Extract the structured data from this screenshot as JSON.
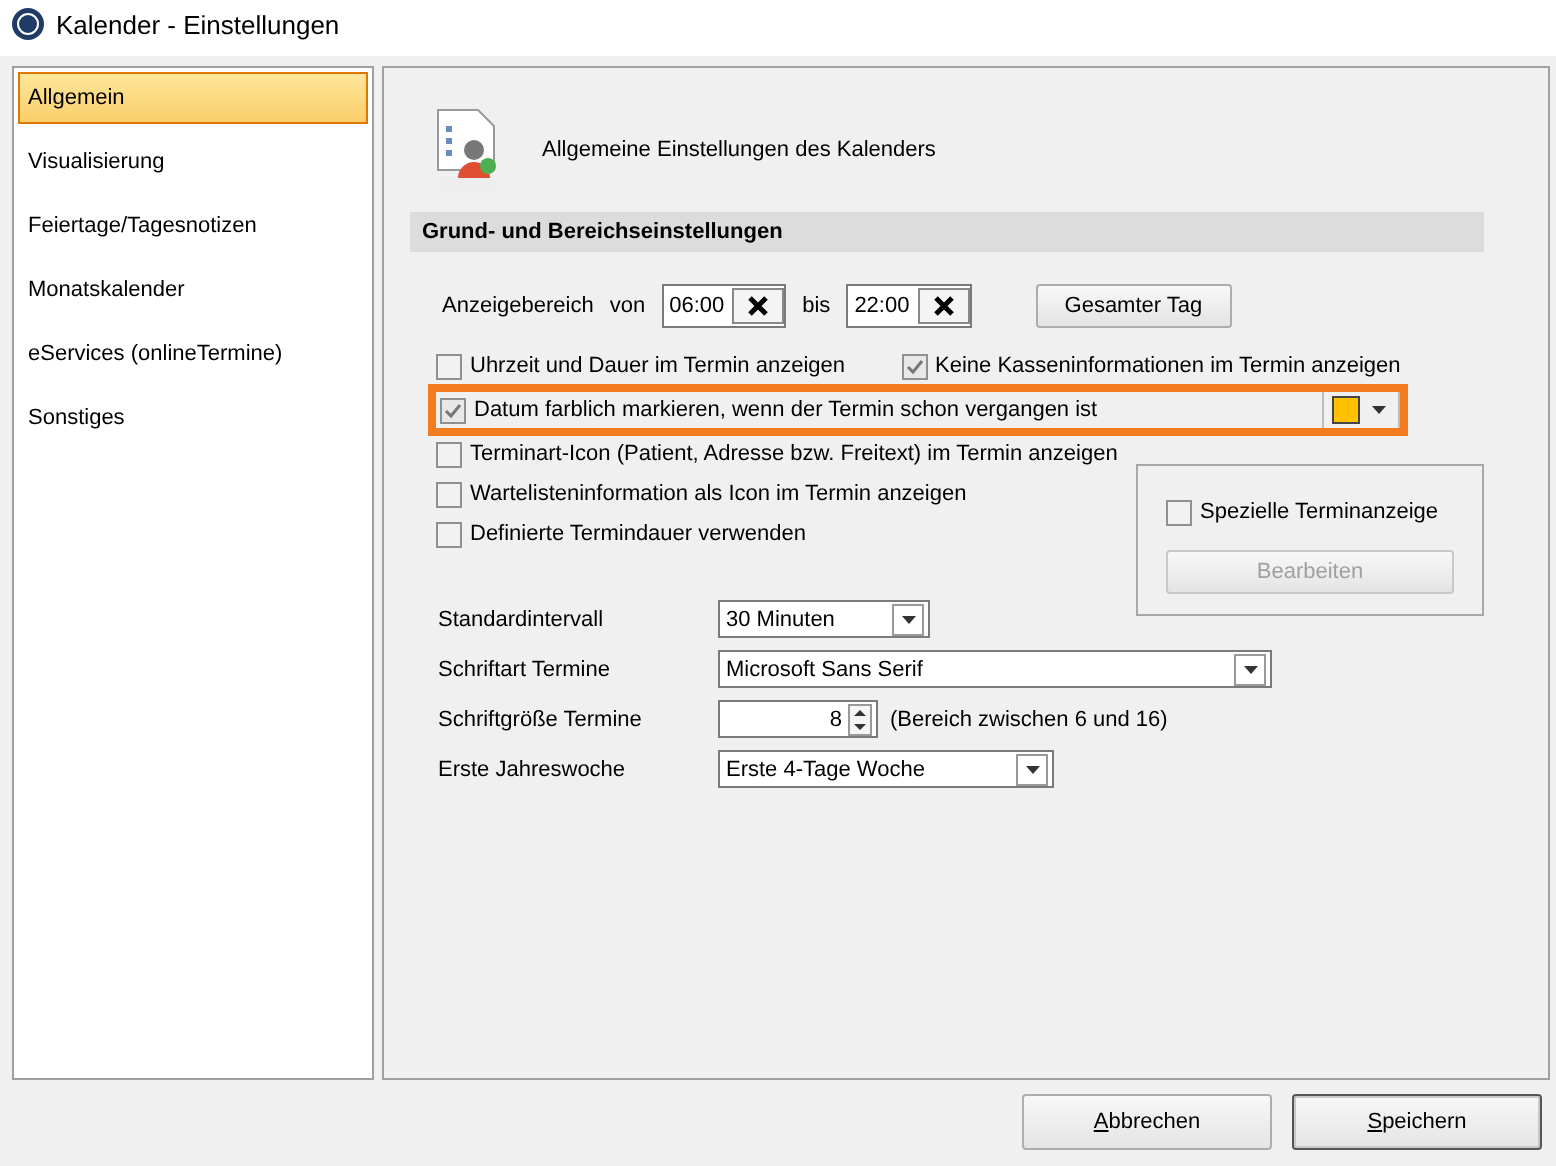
{
  "window": {
    "title": "Kalender - Einstellungen"
  },
  "sidebar": {
    "items": [
      {
        "label": "Allgemein",
        "selected": true
      },
      {
        "label": "Visualisierung",
        "selected": false
      },
      {
        "label": "Feiertage/Tagesnotizen",
        "selected": false
      },
      {
        "label": "Monatskalender",
        "selected": false
      },
      {
        "label": "eServices (onlineTermine)",
        "selected": false
      },
      {
        "label": "Sonstiges",
        "selected": false
      }
    ]
  },
  "header": {
    "text": "Allgemeine Einstellungen des Kalenders"
  },
  "section": {
    "title": "Grund- und Bereichseinstellungen"
  },
  "range": {
    "label": "Anzeigebereich",
    "from_label": "von",
    "from": "06:00",
    "to_label": "bis",
    "to": "22:00",
    "button": "Gesamter Tag"
  },
  "option_rows": [
    [
      {
        "label": "Uhrzeit und Dauer im Termin anzeigen",
        "checked": false,
        "highlighted": false
      },
      {
        "label": "Keine Kasseninformationen im Termin anzeigen",
        "checked": true,
        "highlighted": false
      }
    ],
    [
      {
        "label": "Datum farblich markieren, wenn der Termin schon vergangen ist",
        "checked": true,
        "highlighted": true,
        "color": "#ffc000"
      }
    ],
    [
      {
        "label": "Terminart-Icon (Patient, Adresse bzw. Freitext) im Termin anzeigen",
        "checked": false,
        "highlighted": false
      }
    ],
    [
      {
        "label": "Wartelisteninformation als Icon im Termin anzeigen",
        "checked": false,
        "highlighted": false
      }
    ],
    [
      {
        "label": "Definierte Termindauer  verwenden",
        "checked": false,
        "highlighted": false
      }
    ]
  ],
  "special": {
    "label": "Spezielle Terminanzeige",
    "checked": false,
    "button": "Bearbeiten",
    "button_disabled": true
  },
  "fields": [
    {
      "kind": "combo",
      "label": "Standardintervall",
      "value": "30 Minuten"
    },
    {
      "kind": "combo",
      "label": "Schriftart Termine",
      "value": "Microsoft Sans Serif"
    },
    {
      "kind": "spin",
      "label": "Schriftgröße Termine",
      "value": "8",
      "hint": "(Bereich zwischen 6 und 16)"
    },
    {
      "kind": "combo",
      "label": "Erste Jahreswoche",
      "value": "Erste 4-Tage Woche"
    }
  ],
  "buttons": [
    {
      "label": "Abbrechen",
      "default": false
    },
    {
      "label": "Speichern",
      "default": true
    }
  ]
}
